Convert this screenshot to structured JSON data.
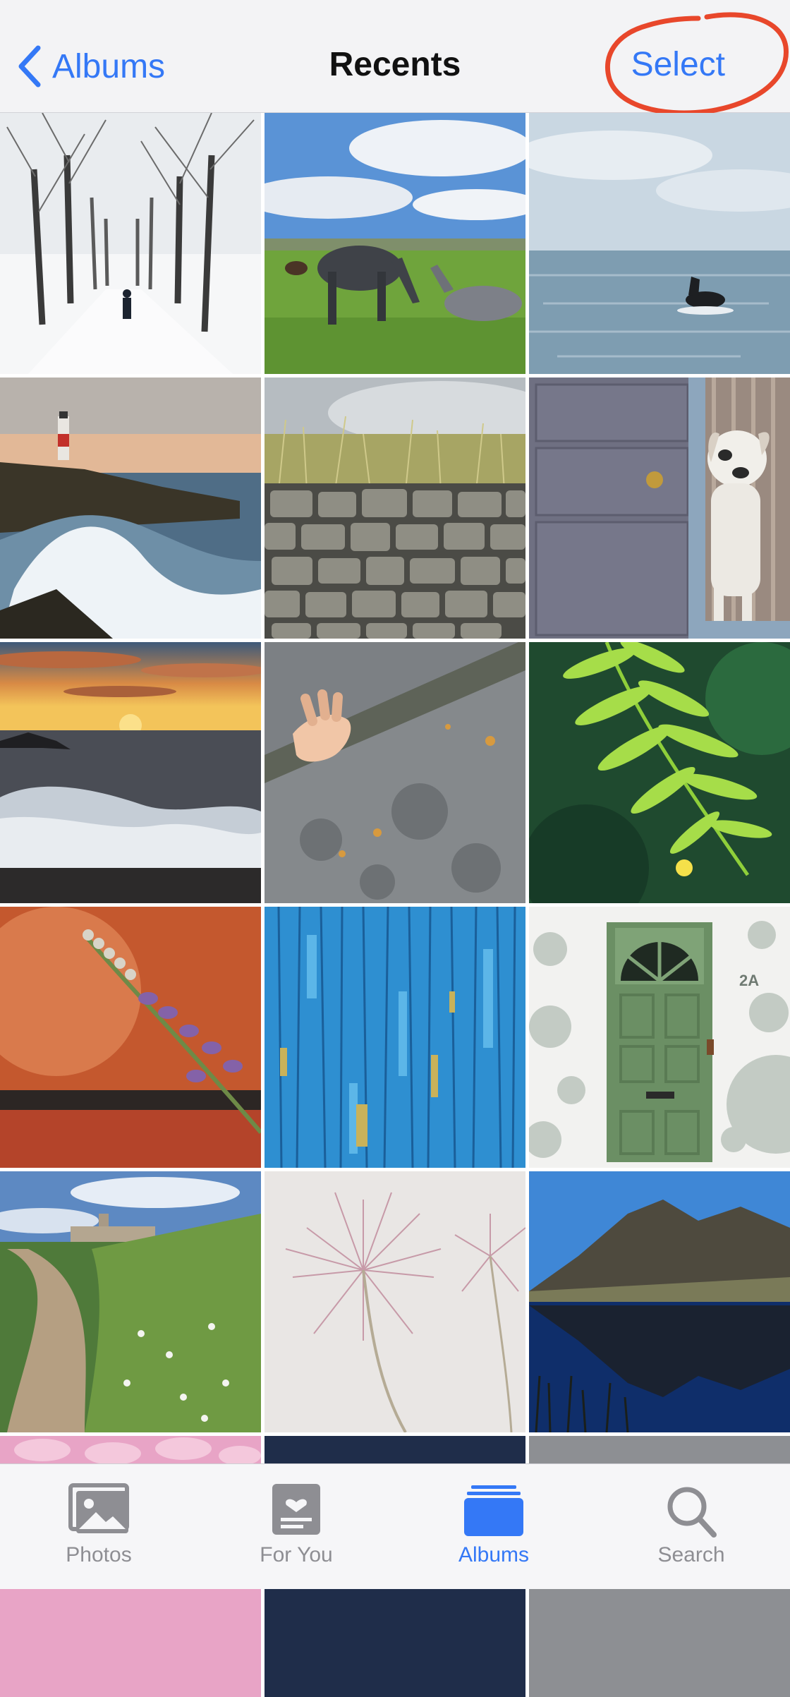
{
  "nav": {
    "back_label": "Albums",
    "title": "Recents",
    "select_label": "Select"
  },
  "photos": [
    {
      "subject": "snowy tree avenue"
    },
    {
      "subject": "grazing horses"
    },
    {
      "subject": "dog in sea"
    },
    {
      "subject": "lighthouse waves"
    },
    {
      "subject": "stone wall grass"
    },
    {
      "subject": "dog at door"
    },
    {
      "subject": "sunset waves"
    },
    {
      "subject": "hand on rock"
    },
    {
      "subject": "green fern"
    },
    {
      "subject": "flower on red wall"
    },
    {
      "subject": "blue peeling paint"
    },
    {
      "subject": "green door 2A"
    },
    {
      "subject": "country path chapel"
    },
    {
      "subject": "allium seed head"
    },
    {
      "subject": "mountain lake reflection"
    }
  ],
  "door_number": "2A",
  "tabbar": {
    "tabs": [
      {
        "label": "Photos",
        "icon": "photos-icon"
      },
      {
        "label": "For You",
        "icon": "for-you-icon"
      },
      {
        "label": "Albums",
        "icon": "albums-icon",
        "active": true
      },
      {
        "label": "Search",
        "icon": "search-icon"
      }
    ]
  },
  "colors": {
    "accent": "#3478f6",
    "inactive": "#8e8e93",
    "annotation": "#e8472b"
  }
}
